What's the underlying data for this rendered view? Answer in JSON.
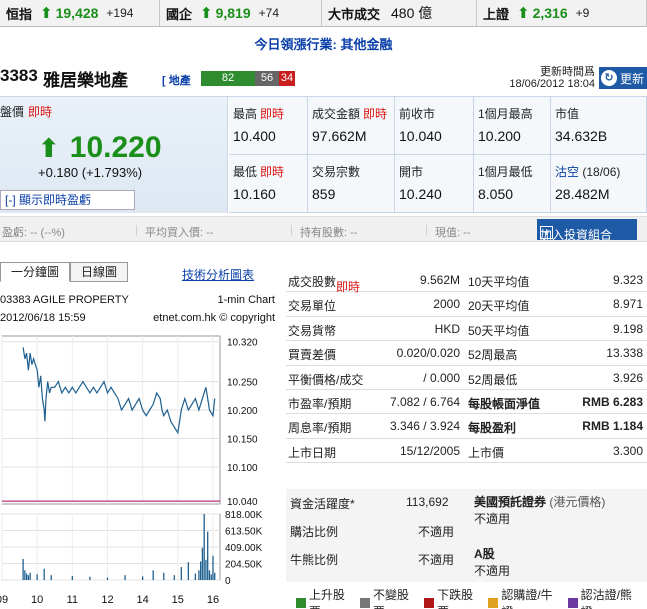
{
  "ticker": [
    {
      "name": "恒指",
      "value": "19,428",
      "change": "+194",
      "arrow": true
    },
    {
      "name": "國企",
      "value": "9,819",
      "change": "+74",
      "arrow": true
    },
    {
      "name": "大市成交",
      "value": "480 億",
      "change": "",
      "arrow": false
    },
    {
      "name": "上證",
      "value": "2,316",
      "change": "+9",
      "arrow": true
    }
  ],
  "leading": {
    "label": "今日領漲行業:",
    "value": "其他金融"
  },
  "stock": {
    "code": "3383",
    "name": "雅居樂地產",
    "sector": "[ 地產",
    "bars": [
      {
        "v": "82",
        "color": "#2e8b2e",
        "w": 54
      },
      {
        "v": "56",
        "color": "#666666",
        "w": 24
      },
      {
        "v": "34",
        "color": "#c81e1e",
        "w": 16
      }
    ],
    "update_label": "更新時間爲",
    "update_time": "18/06/2012 18:04",
    "refresh": "更新"
  },
  "quote": {
    "price_label": "盤價",
    "live": "即時",
    "price": "10.220",
    "change": "+0.180 (+1.793%)",
    "show_button": "[-] 顯示即時盈虧",
    "cells": [
      {
        "label": "最高",
        "live": "即時",
        "value": "10.400"
      },
      {
        "label": "成交金額",
        "live": "即時",
        "value": "97.662M"
      },
      {
        "label": "前收市",
        "live": "",
        "value": "10.040"
      },
      {
        "label": "1個月最高",
        "live": "",
        "value": "10.200"
      },
      {
        "label": "市值",
        "live": "",
        "value": "34.632B"
      },
      {
        "label": "最低",
        "live": "即時",
        "value": "10.160"
      },
      {
        "label": "交易宗數",
        "live": "",
        "value": "859"
      },
      {
        "label": "開市",
        "live": "",
        "value": "10.240"
      },
      {
        "label": "1個月最低",
        "live": "",
        "value": "8.050"
      },
      {
        "label": "沽空",
        "label_extra": "(18/06)",
        "live": "",
        "value": "28.482M"
      }
    ]
  },
  "portfolio": {
    "pl": "盈虧: -- (--%)",
    "avg": "平均買入價: --",
    "shares": "持有股數: --",
    "now": "現值: --",
    "add": "加入投資組合"
  },
  "chart": {
    "tabs": [
      "一分鐘圖",
      "日線圖"
    ],
    "tech_link": "技術分析圖表",
    "title_left": "03383 AGILE PROPERTY",
    "title_right": "1-min Chart",
    "date": "2012/06/18 15:59",
    "source": "etnet.com.hk © copyright"
  },
  "chart_data": {
    "type": "line",
    "price_ticks": [
      "10.320",
      "10.250",
      "10.200",
      "10.150",
      "10.100",
      "10.040"
    ],
    "price_values": [
      10.32,
      10.25,
      10.2,
      10.15,
      10.1,
      10.04
    ],
    "prev_close": 10.04,
    "volume_ticks": [
      "818.00K",
      "613.50K",
      "409.00K",
      "204.50K",
      "0"
    ],
    "volume_values": [
      818,
      613.5,
      409,
      204.5,
      0
    ],
    "x_ticks": [
      "09",
      "10",
      "11",
      "12",
      "14",
      "15",
      "16"
    ],
    "x_values": [
      9.0,
      10.0,
      11.0,
      12.0,
      14.0,
      15.0,
      16.0
    ],
    "x_tick_pos": [
      9.0,
      10.0,
      11.0,
      12.0,
      13.0,
      14.0,
      15.0
    ],
    "price_series": [
      [
        9.6,
        10.31
      ],
      [
        9.65,
        10.29
      ],
      [
        9.7,
        10.3
      ],
      [
        9.75,
        10.27
      ],
      [
        9.8,
        10.3
      ],
      [
        9.85,
        10.28
      ],
      [
        9.9,
        10.29
      ],
      [
        10.0,
        10.27
      ],
      [
        10.05,
        10.24
      ],
      [
        10.1,
        10.26
      ],
      [
        10.15,
        10.22
      ],
      [
        10.2,
        10.2
      ],
      [
        10.22,
        10.18
      ],
      [
        10.25,
        10.22
      ],
      [
        10.3,
        10.25
      ],
      [
        10.35,
        10.23
      ],
      [
        10.4,
        10.24
      ],
      [
        10.5,
        10.24
      ],
      [
        10.6,
        10.25
      ],
      [
        10.7,
        10.23
      ],
      [
        10.8,
        10.24
      ],
      [
        10.9,
        10.23
      ],
      [
        11.0,
        10.24
      ],
      [
        11.1,
        10.23
      ],
      [
        11.2,
        10.24
      ],
      [
        11.3,
        10.25
      ],
      [
        11.4,
        10.24
      ],
      [
        11.5,
        10.23
      ],
      [
        11.6,
        10.24
      ],
      [
        11.7,
        10.23
      ],
      [
        11.8,
        10.24
      ],
      [
        11.9,
        10.25
      ],
      [
        12.0,
        10.23
      ],
      [
        12.1,
        10.24
      ],
      [
        12.2,
        10.23
      ],
      [
        12.3,
        10.22
      ],
      [
        12.4,
        10.2
      ],
      [
        12.5,
        10.21
      ],
      [
        12.6,
        10.22
      ],
      [
        12.7,
        10.2
      ],
      [
        12.8,
        10.21
      ],
      [
        12.9,
        10.22
      ],
      [
        13.0,
        10.2
      ],
      [
        13.1,
        10.19
      ],
      [
        13.2,
        10.2
      ],
      [
        13.3,
        10.21
      ],
      [
        13.35,
        10.22
      ],
      [
        13.4,
        10.23
      ],
      [
        13.5,
        10.22
      ],
      [
        13.55,
        10.2
      ],
      [
        13.6,
        10.19
      ],
      [
        13.7,
        10.2
      ],
      [
        13.8,
        10.18
      ],
      [
        13.9,
        10.17
      ],
      [
        14.0,
        10.16
      ],
      [
        14.05,
        10.18
      ],
      [
        14.1,
        10.2
      ],
      [
        14.2,
        10.22
      ],
      [
        14.3,
        10.2
      ],
      [
        14.4,
        10.21
      ],
      [
        14.5,
        10.22
      ],
      [
        14.6,
        10.2
      ],
      [
        14.7,
        10.22
      ],
      [
        14.8,
        10.24
      ],
      [
        14.85,
        10.22
      ],
      [
        14.9,
        10.2
      ],
      [
        15.0,
        10.19
      ],
      [
        15.05,
        10.22
      ]
    ],
    "volume_series": [
      [
        9.6,
        260
      ],
      [
        9.65,
        120
      ],
      [
        9.7,
        80
      ],
      [
        9.75,
        60
      ],
      [
        9.8,
        90
      ],
      [
        10.0,
        70
      ],
      [
        10.2,
        140
      ],
      [
        10.4,
        60
      ],
      [
        11.0,
        50
      ],
      [
        11.5,
        40
      ],
      [
        12.0,
        30
      ],
      [
        12.5,
        60
      ],
      [
        13.0,
        45
      ],
      [
        13.3,
        120
      ],
      [
        13.6,
        90
      ],
      [
        13.9,
        60
      ],
      [
        14.1,
        160
      ],
      [
        14.3,
        220
      ],
      [
        14.5,
        80
      ],
      [
        14.6,
        120
      ],
      [
        14.65,
        230
      ],
      [
        14.7,
        400
      ],
      [
        14.75,
        818
      ],
      [
        14.8,
        250
      ],
      [
        14.85,
        600
      ],
      [
        14.9,
        120
      ],
      [
        14.95,
        70
      ],
      [
        15.0,
        300
      ],
      [
        15.05,
        90
      ]
    ],
    "xlim": [
      9.0,
      15.2
    ],
    "ylim": [
      10.035,
      10.33
    ],
    "vlim": [
      0,
      818
    ]
  },
  "stats": [
    {
      "l1": "成交股數",
      "live": "即時",
      "v1": "9.562M",
      "l2": "10天平均值",
      "v2": "9.323",
      "bold": false
    },
    {
      "l1": "交易單位",
      "live": "",
      "v1": "2000",
      "l2": "20天平均值",
      "v2": "8.971",
      "bold": false
    },
    {
      "l1": "交易貨幣",
      "live": "",
      "v1": "HKD",
      "l2": "50天平均值",
      "v2": "9.198",
      "bold": false
    },
    {
      "l1": "買賣差價",
      "live": "",
      "v1": "0.020/0.020",
      "l2": "52周最高",
      "v2": "13.338",
      "bold": false
    },
    {
      "l1": "平衡價格/成交",
      "live": "",
      "v1": "/ 0.000",
      "l2": "52周最低",
      "v2": "3.926",
      "bold": false
    },
    {
      "l1": "市盈率/預期",
      "live": "",
      "v1": "7.082 / 6.764",
      "l2": "每股帳面淨值",
      "v2": "RMB 6.283",
      "bold": true
    },
    {
      "l1": "周息率/預期",
      "live": "",
      "v1": "3.346 / 3.924",
      "l2": "每股盈利",
      "v2": "RMB 1.184",
      "bold": true
    },
    {
      "l1": "上市日期",
      "live": "",
      "v1": "15/12/2005",
      "l2": "上市價",
      "v2": "3.300",
      "bold": false
    }
  ],
  "lower": {
    "flow_label": "資金活躍度*",
    "flow_value": "113,692",
    "adr_label": "美國預託證券",
    "adr_sub": "(港元價格)",
    "adr_value": "不適用",
    "bull_label": "購沽比例",
    "bull_value": "不適用",
    "bear_label": "牛熊比例",
    "bear_value": "不適用",
    "a_label": "A股",
    "a_value": "不適用"
  },
  "legend": [
    {
      "label": "上升股票",
      "color": "#2e8b2e"
    },
    {
      "label": "不變股票",
      "color": "#777777"
    },
    {
      "label": "下跌股票",
      "color": "#b01818"
    },
    {
      "label": "認購證/牛證",
      "color": "#e0a020"
    },
    {
      "label": "認沽證/熊證",
      "color": "#6a3aa0"
    }
  ]
}
